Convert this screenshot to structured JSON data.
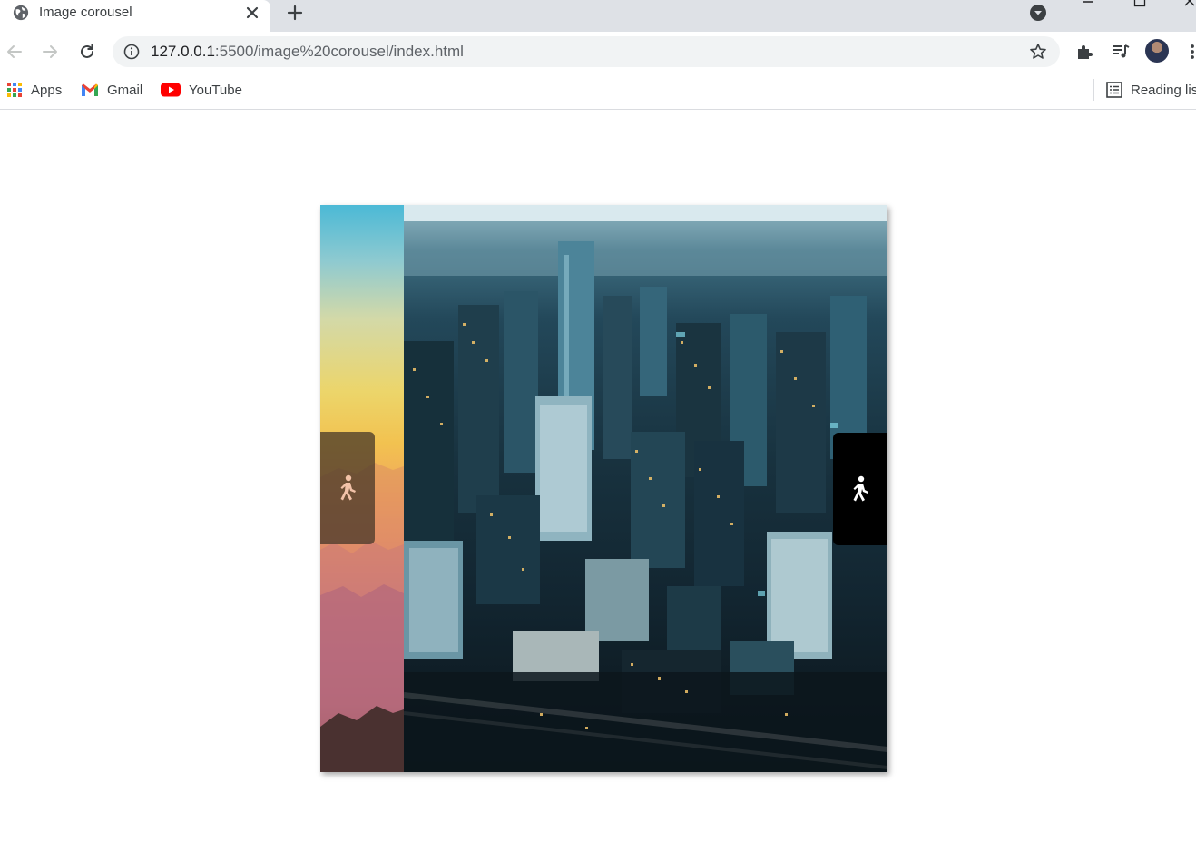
{
  "browser": {
    "tab": {
      "title": "Image corousel"
    },
    "omnibox": {
      "host": "127.0.0.1",
      "path": ":5500/image%20corousel/index.html"
    },
    "bookmarks": [
      {
        "label": "Apps",
        "icon": "apps-grid-icon"
      },
      {
        "label": "Gmail",
        "icon": "gmail-icon"
      },
      {
        "label": "YouTube",
        "icon": "youtube-icon"
      }
    ],
    "reading_list": {
      "label": "Reading lis"
    }
  },
  "carousel": {
    "prev_button": {
      "icon": "walking-person-icon",
      "color": "#f2c2a8"
    },
    "next_button": {
      "icon": "walking-person-icon",
      "color": "#ffffff"
    },
    "slides": [
      {
        "name": "sunset-mountains-slide",
        "state": "previous"
      },
      {
        "name": "city-aerial-slide",
        "state": "current"
      }
    ]
  },
  "colors": {
    "tabstrip": "#dee1e6",
    "omnibox": "#f1f3f4",
    "next_button_bg": "#000000"
  }
}
